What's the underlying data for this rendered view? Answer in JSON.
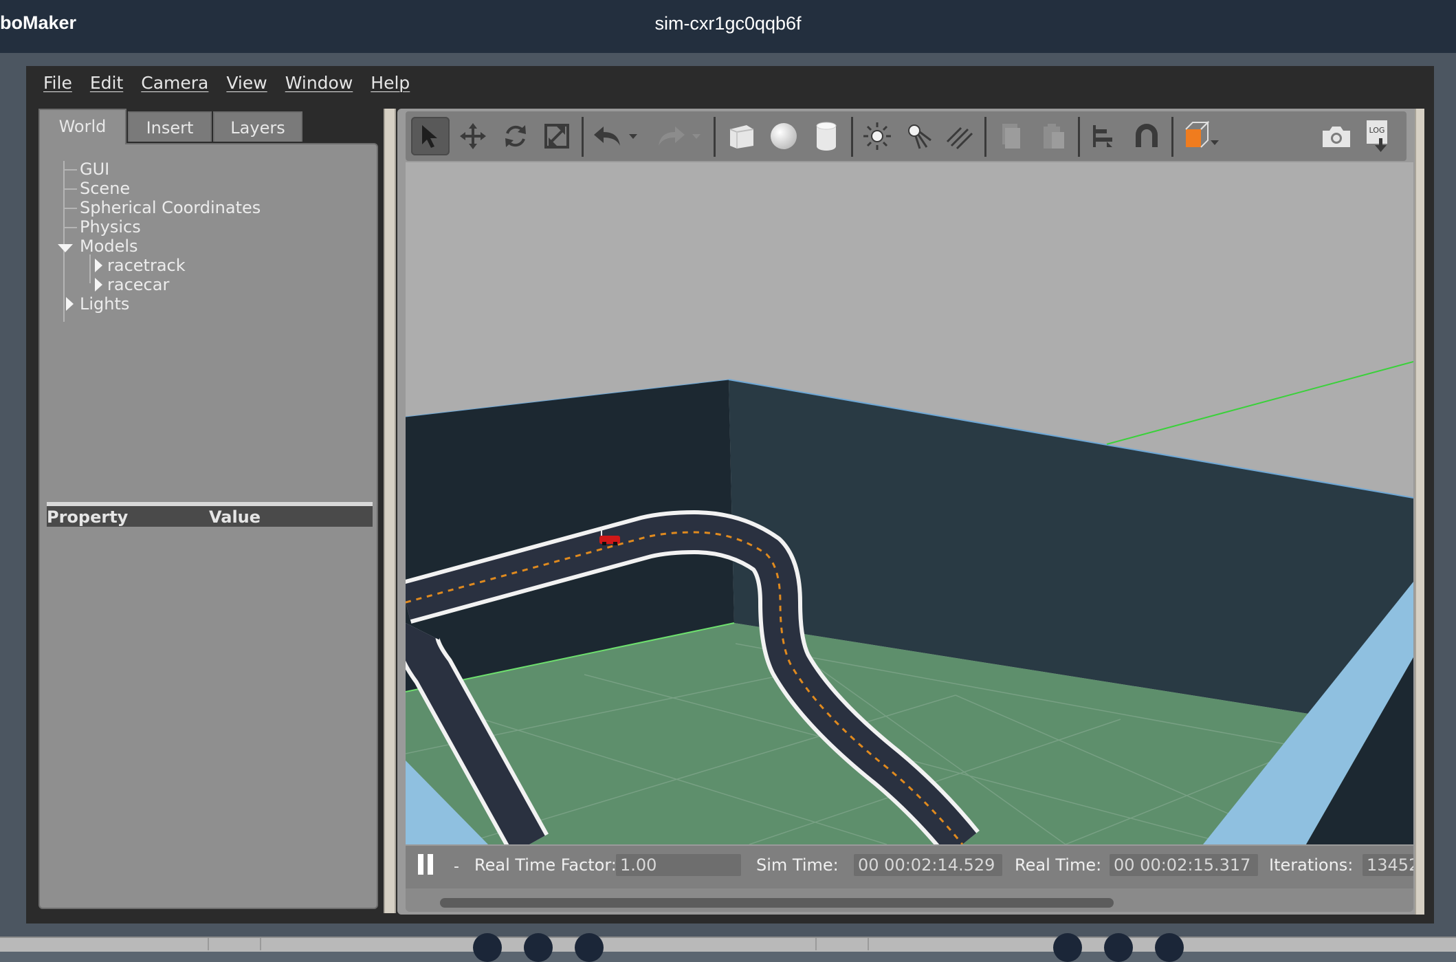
{
  "header": {
    "app_name": "boMaker",
    "simulation_name": "sim-cxr1gc0qqb6f"
  },
  "menu": [
    "File",
    "Edit",
    "Camera",
    "View",
    "Window",
    "Help"
  ],
  "left_panel": {
    "tabs": [
      "World",
      "Insert",
      "Layers"
    ],
    "active_tab": "World",
    "tree": {
      "gui": "GUI",
      "scene": "Scene",
      "spherical_coordinates": "Spherical Coordinates",
      "physics": "Physics",
      "models": "Models",
      "model_children": [
        "racetrack",
        "racecar"
      ],
      "lights": "Lights"
    },
    "property_header": {
      "property": "Property",
      "value": "Value"
    }
  },
  "toolbar": {
    "icons": [
      "select-arrow-icon",
      "translate-icon",
      "rotate-icon",
      "scale-icon",
      "undo-icon",
      "undo-dropdown-icon",
      "redo-icon",
      "redo-dropdown-icon",
      "box-shape-icon",
      "sphere-shape-icon",
      "cylinder-shape-icon",
      "point-light-icon",
      "spot-light-icon",
      "directional-light-icon",
      "copy-icon",
      "paste-icon",
      "align-icon",
      "snap-magnet-icon",
      "view-angle-icon",
      "screenshot-icon",
      "log-icon"
    ],
    "log_label": "LOG"
  },
  "status": {
    "pause_icon": "pause-icon",
    "step_label": "-",
    "real_time_factor_label": "Real Time Factor:",
    "real_time_factor_value": "1.00",
    "sim_time_label": "Sim Time:",
    "sim_time_value": "00 00:02:14.529",
    "real_time_label": "Real Time:",
    "real_time_value": "00 00:02:15.317",
    "iterations_label": "Iterations:",
    "iterations_value": "13452"
  },
  "colors": {
    "topbar": "#232f3e",
    "panel": "#8f8f8f",
    "sky": "#adadad",
    "wall_dark": "#1e2a33",
    "wall_mid": "#2a3b45",
    "ground": "#5e8f6c",
    "track": "#2a3140",
    "track_line_white": "#f2f2f2",
    "track_center_orange": "#e08a1e",
    "car": "#d01818",
    "axis_green": "#3ad13a",
    "water_blue": "#8fc0e0"
  }
}
